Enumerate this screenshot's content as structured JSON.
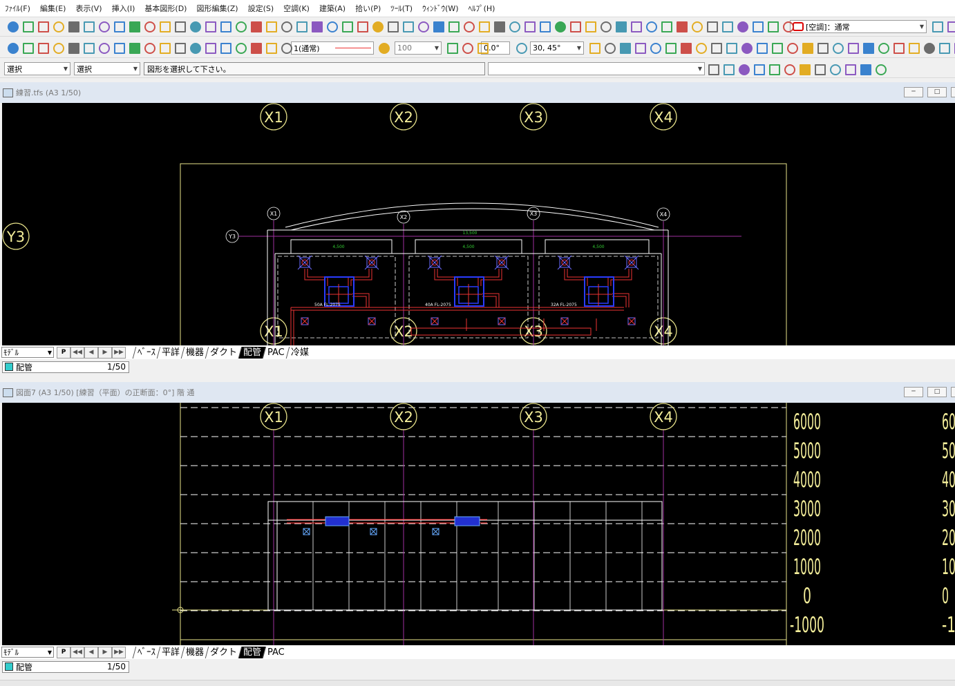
{
  "menu": [
    "ﾌｧｲﾙ(F)",
    "編集(E)",
    "表示(V)",
    "挿入(I)",
    "基本図形(D)",
    "図形編集(Z)",
    "設定(S)",
    "空調(K)",
    "建築(A)",
    "拾い(P)",
    "ﾂｰﾙ(T)",
    "ｳｨﾝﾄﾞｳ(W)",
    "ﾍﾙﾌﾟ(H)"
  ],
  "toolbar1": {
    "mode_combo": "[空調]：通常"
  },
  "toolbar2": {
    "linetype": "1(通常)",
    "opacity": "100",
    "angle": "0.0°",
    "snap_angle": "30, 45°"
  },
  "toolbar3": {
    "select1": "選択",
    "select2": "選択",
    "message": "図形を選択して下さい。",
    "command_combo": ""
  },
  "window1": {
    "title": "練習.tfs (A3 1/50)",
    "big_labels": {
      "x1": "X1",
      "x2": "X2",
      "x3": "X3",
      "x4": "X4",
      "y3": "Y3"
    },
    "small_labels": {
      "x1": "X1",
      "x2": "X2",
      "x3": "X3",
      "x4": "X4",
      "y3": "Y3"
    },
    "dims": [
      "4,500",
      "4,500",
      "4,500",
      "13,500"
    ],
    "pipe_labels": [
      "50A FL-2075",
      "40A FL-2075",
      "32A FL-2075"
    ],
    "space_model": "ﾓﾃﾞﾙ",
    "p_button": "P",
    "tabs": [
      "ﾍﾞｰｽ",
      "平詳",
      "機器",
      "ダクト",
      "配管",
      "PAC",
      "冷媒"
    ],
    "active_tab": "配管",
    "layer": "配管",
    "scale": "1/50"
  },
  "window2": {
    "title": "図面7 (A3 1/50) [練習（平面）の正断面：0°] 階 通",
    "big_labels": {
      "x1": "X1",
      "x2": "X2",
      "x3": "X3",
      "x4": "X4"
    },
    "levels": [
      "6000",
      "5000",
      "4000",
      "3000",
      "2000",
      "1000",
      "0",
      "-1000"
    ],
    "levels_clipped": [
      "60",
      "50",
      "40",
      "30",
      "20",
      "10",
      "0",
      "-1"
    ],
    "space_model": "ﾓﾃﾞﾙ",
    "p_button": "P",
    "tabs": [
      "ﾍﾞｰｽ",
      "平詳",
      "機器",
      "ダクト",
      "配管",
      "PAC"
    ],
    "active_tab": "配管",
    "layer": "配管",
    "scale": "1/50"
  }
}
